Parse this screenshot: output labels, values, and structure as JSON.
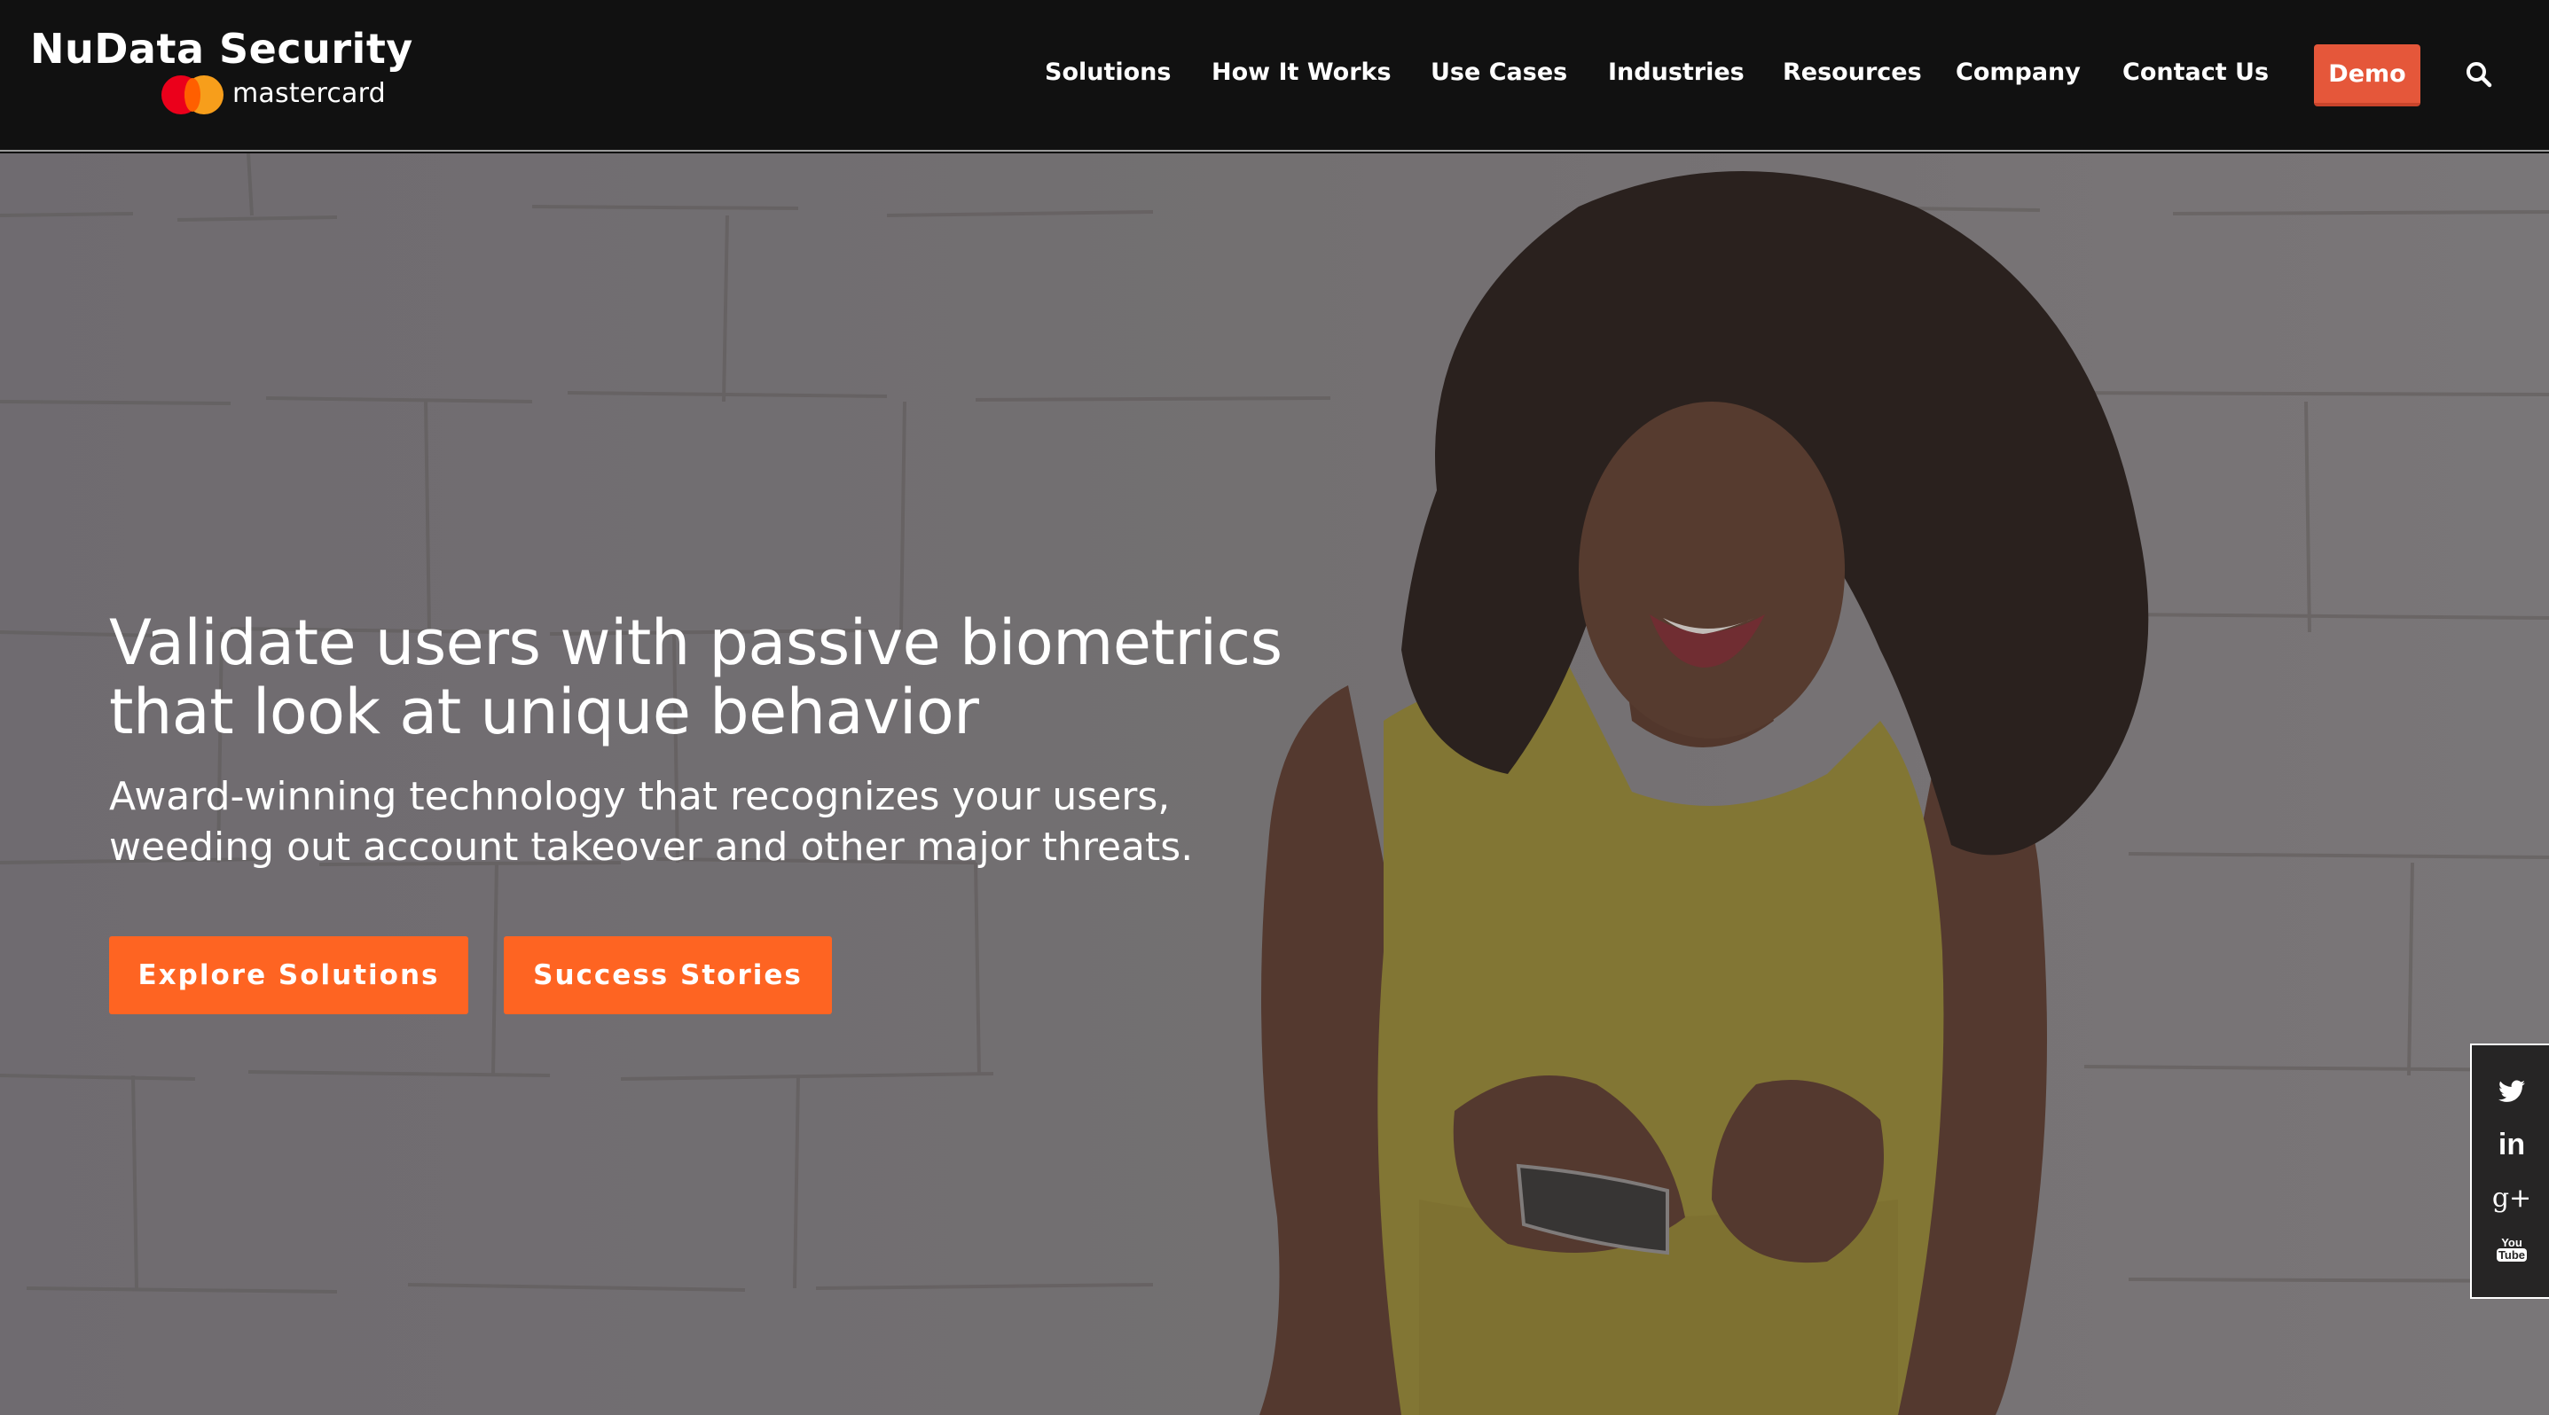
{
  "brand": {
    "name": "NuData Security",
    "parent": "mastercard",
    "colors": {
      "header_bg": "#111111",
      "demo_button": "#e5573a",
      "cta_button": "#fe6422",
      "mastercard_red": "#eb001b",
      "mastercard_yellow": "#f79e1b"
    }
  },
  "nav": {
    "items": [
      {
        "label": "Solutions"
      },
      {
        "label": "How It Works"
      },
      {
        "label": "Use Cases"
      },
      {
        "label": "Industries"
      },
      {
        "label": "Resources"
      },
      {
        "label": "Company"
      },
      {
        "label": "Contact Us"
      }
    ],
    "demo_label": "Demo",
    "search_icon": "search-icon"
  },
  "hero": {
    "title_lines": [
      "Validate users with passive biometrics",
      "that look at unique behavior"
    ],
    "subtitle_lines": [
      "Award-winning technology that recognizes your users,",
      "weeding out account takeover and other major threats."
    ],
    "buttons": [
      {
        "label": "Explore Solutions"
      },
      {
        "label": "Success Stories"
      }
    ],
    "image": "woman-in-yellow-top-using-smartphone-against-white-brick-wall"
  },
  "social": {
    "items": [
      {
        "icon": "twitter-icon"
      },
      {
        "icon": "linkedin-icon",
        "glyph": "in"
      },
      {
        "icon": "google-plus-icon",
        "glyph": "g+"
      },
      {
        "icon": "youtube-icon",
        "glyph_top": "You",
        "glyph_bottom": "Tube"
      }
    ]
  }
}
